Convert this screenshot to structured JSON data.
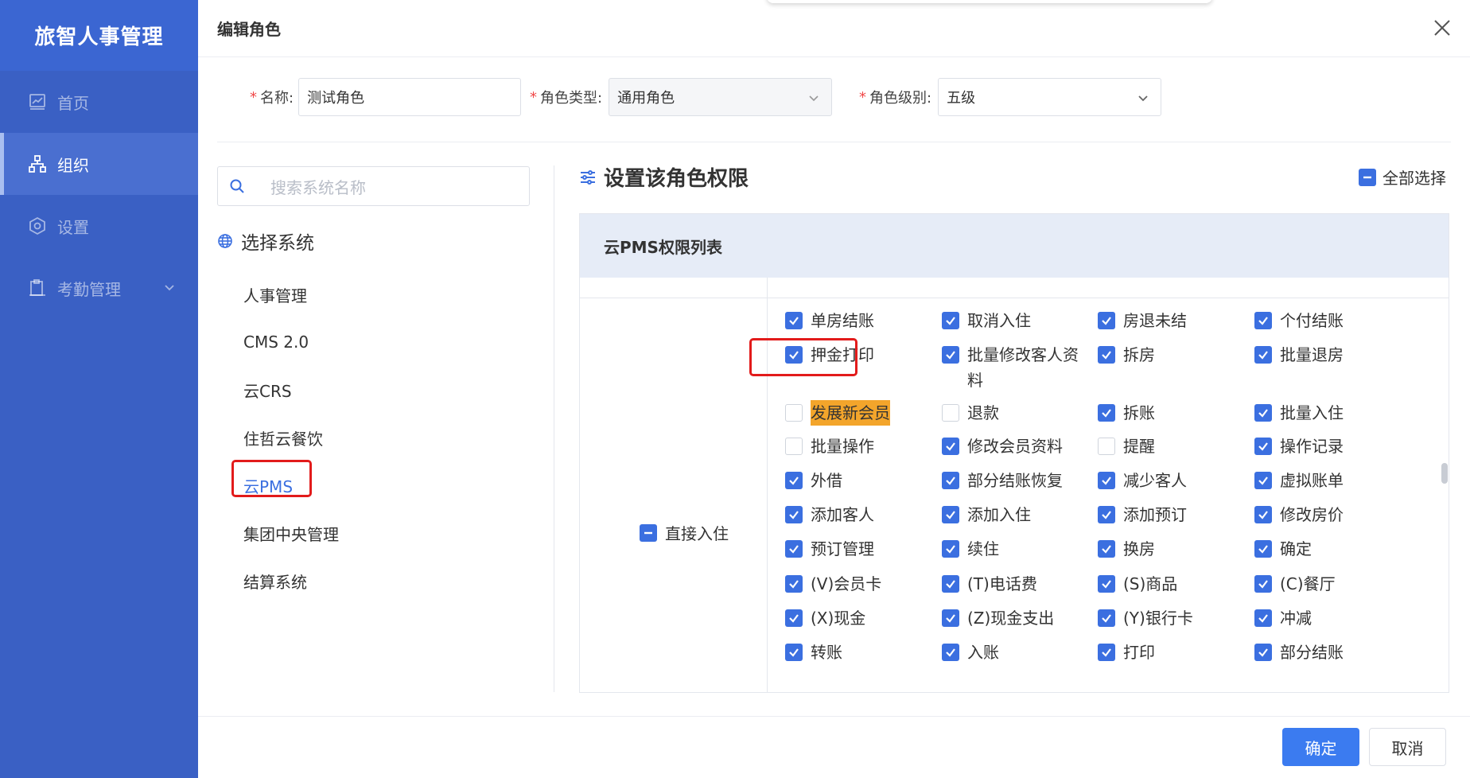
{
  "brand": "旅智人事管理",
  "nav": [
    {
      "label": "首页",
      "icon": "chart-icon"
    },
    {
      "label": "组织",
      "icon": "org-icon"
    },
    {
      "label": "设置",
      "icon": "gear-icon"
    },
    {
      "label": "考勤管理",
      "icon": "clipboard-icon"
    }
  ],
  "dialog": {
    "title": "编辑角色",
    "name_label": "名称:",
    "name_value": "测试角色",
    "type_label": "角色类型:",
    "type_value": "通用角色",
    "level_label": "角色级别:",
    "level_value": "五级",
    "search_placeholder": "搜索系统名称",
    "system_heading": "选择系统",
    "systems": [
      "人事管理",
      "CMS 2.0",
      "云CRS",
      "住哲云餐饮",
      "云PMS",
      "集团中央管理",
      "结算系统"
    ],
    "perm_title": "设置该角色权限",
    "select_all": "全部选择",
    "table_title": "云PMS权限列表",
    "group_label": "直接入住",
    "confirm": "确定",
    "cancel": "取消"
  },
  "permissions": [
    [
      {
        "label": "单房结账",
        "checked": true
      },
      {
        "label": "取消入住",
        "checked": true
      },
      {
        "label": "房退未结",
        "checked": true
      },
      {
        "label": "个付结账",
        "checked": true
      }
    ],
    [
      {
        "label": "押金打印",
        "checked": true
      },
      {
        "label": "批量修改客人资料",
        "checked": true
      },
      {
        "label": "拆房",
        "checked": true
      },
      {
        "label": "批量退房",
        "checked": true
      }
    ],
    [
      {
        "label": "发展新会员",
        "checked": false,
        "highlight": true
      },
      {
        "label": "退款",
        "checked": false
      },
      {
        "label": "拆账",
        "checked": true
      },
      {
        "label": "批量入住",
        "checked": true
      }
    ],
    [
      {
        "label": "批量操作",
        "checked": false
      },
      {
        "label": "修改会员资料",
        "checked": true
      },
      {
        "label": "提醒",
        "checked": false
      },
      {
        "label": "操作记录",
        "checked": true
      }
    ],
    [
      {
        "label": "外借",
        "checked": true
      },
      {
        "label": "部分结账恢复",
        "checked": true
      },
      {
        "label": "减少客人",
        "checked": true
      },
      {
        "label": "虚拟账单",
        "checked": true
      }
    ],
    [
      {
        "label": "添加客人",
        "checked": true
      },
      {
        "label": "添加入住",
        "checked": true
      },
      {
        "label": "添加预订",
        "checked": true
      },
      {
        "label": "修改房价",
        "checked": true
      }
    ],
    [
      {
        "label": "预订管理",
        "checked": true
      },
      {
        "label": "续住",
        "checked": true
      },
      {
        "label": "换房",
        "checked": true
      },
      {
        "label": "确定",
        "checked": true
      }
    ],
    [
      {
        "label": "(V)会员卡",
        "checked": true
      },
      {
        "label": "(T)电话费",
        "checked": true
      },
      {
        "label": "(S)商品",
        "checked": true
      },
      {
        "label": "(C)餐厅",
        "checked": true
      }
    ],
    [
      {
        "label": "(X)现金",
        "checked": true
      },
      {
        "label": "(Z)现金支出",
        "checked": true
      },
      {
        "label": "(Y)银行卡",
        "checked": true
      },
      {
        "label": "冲减",
        "checked": true
      }
    ],
    [
      {
        "label": "转账",
        "checked": true
      },
      {
        "label": "入账",
        "checked": true
      },
      {
        "label": "打印",
        "checked": true
      },
      {
        "label": "部分结账",
        "checked": true
      }
    ]
  ],
  "colors": {
    "primary": "#3b6fe0",
    "sidebar": "#3a60c4",
    "highlight": "#f3a52b",
    "annotation": "#e21b1b"
  }
}
